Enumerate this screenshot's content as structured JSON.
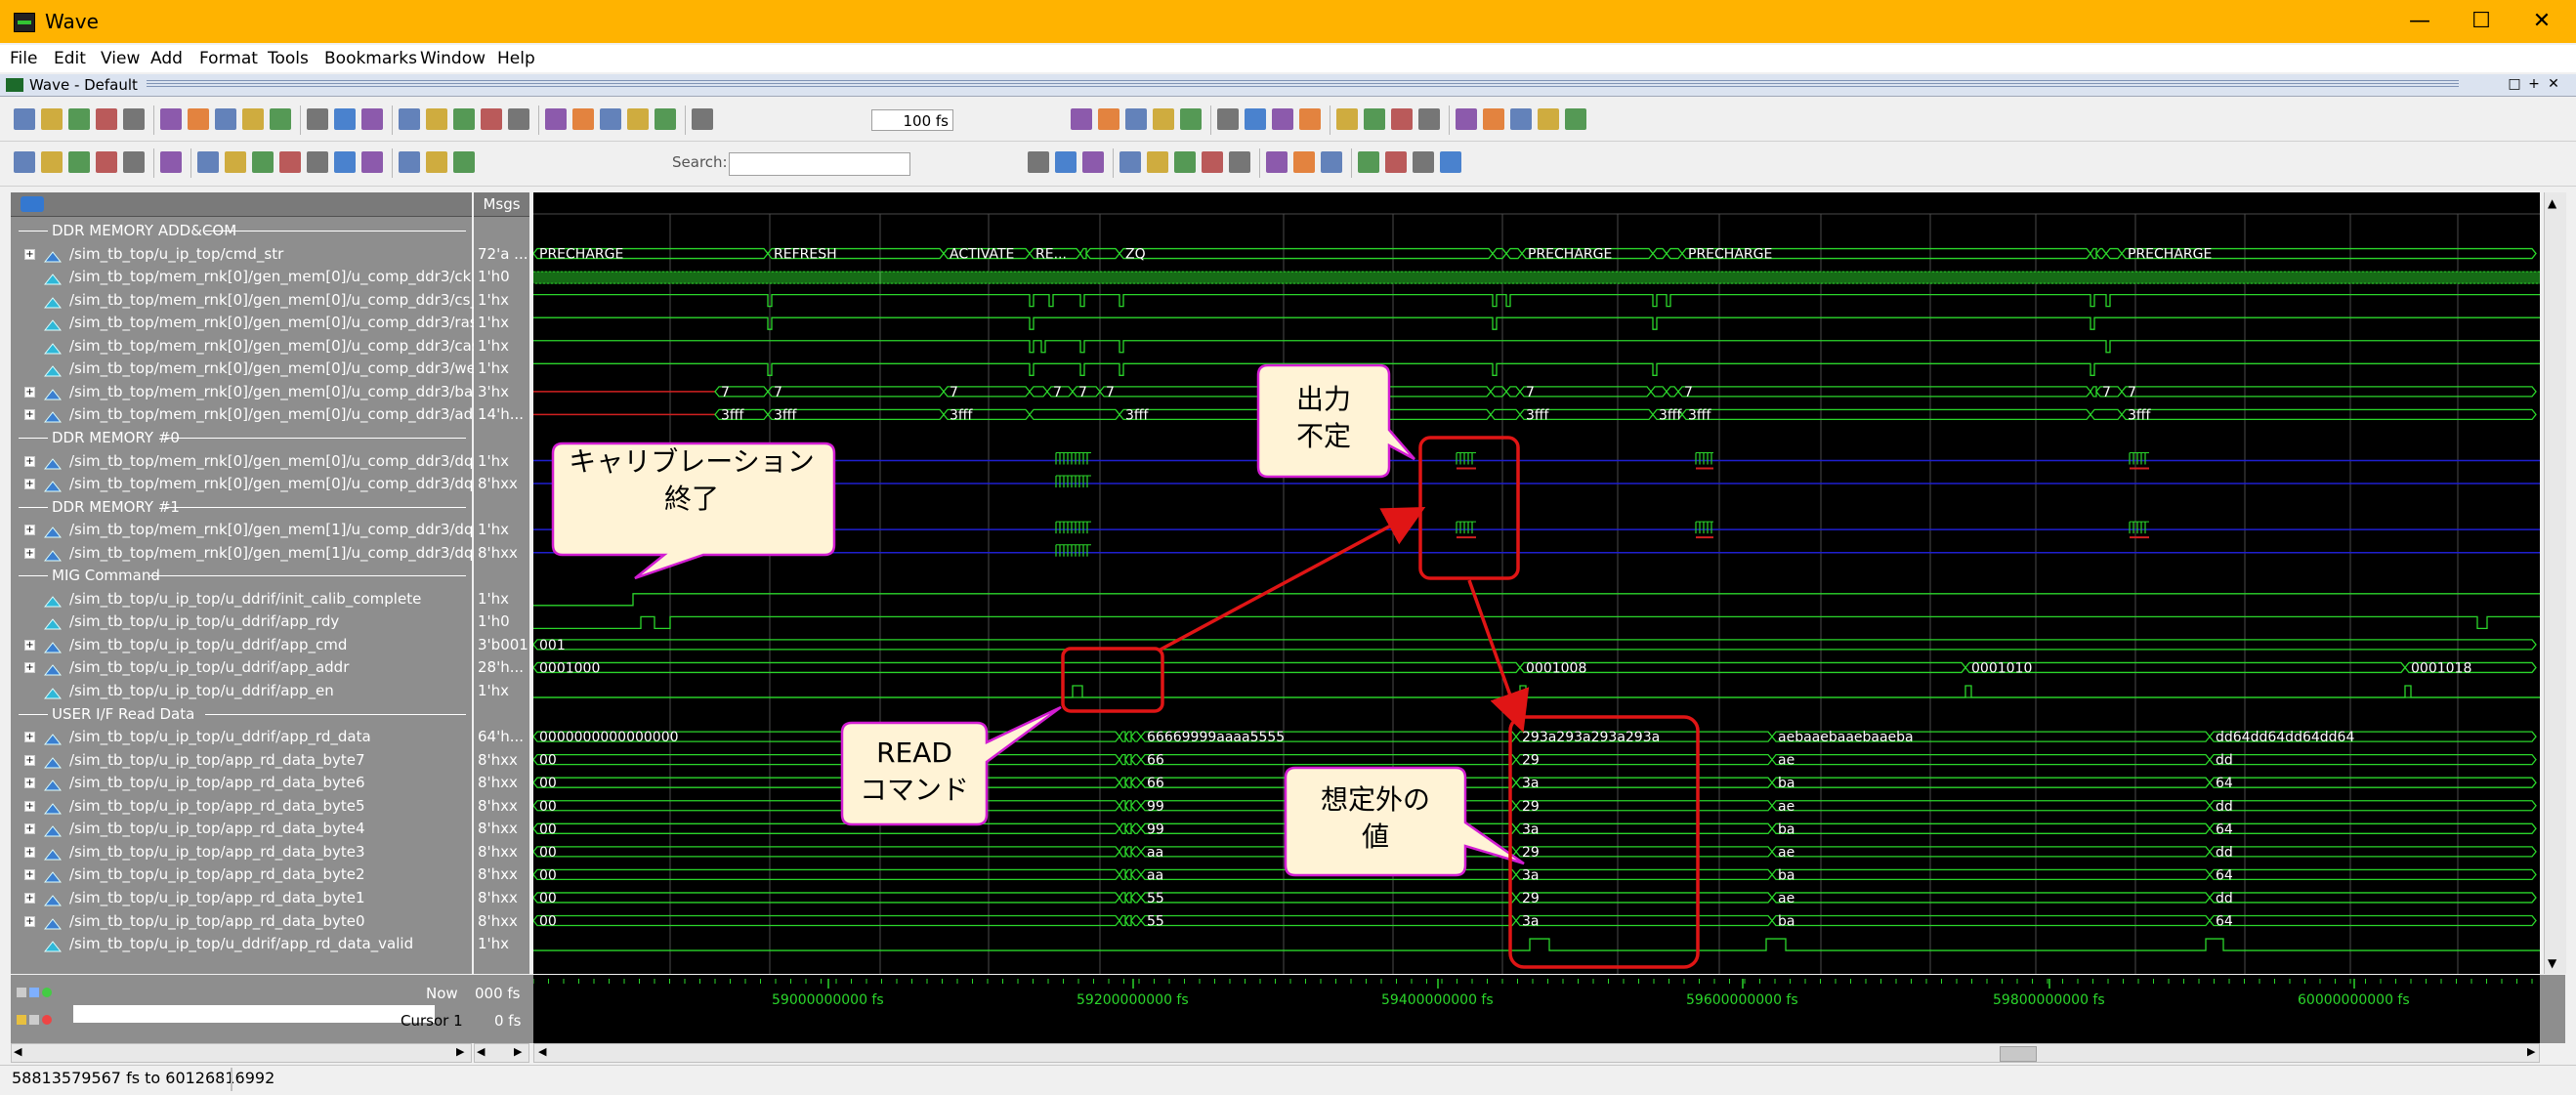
{
  "window": {
    "title": "Wave",
    "subwindow_title": "Wave - Default"
  },
  "menu": [
    "File",
    "Edit",
    "View",
    "Add",
    "Format",
    "Tools",
    "Bookmarks",
    "Window",
    "Help"
  ],
  "toolbar": {
    "zoom_value": "100 fs",
    "search_label": "Search:",
    "search_value": ""
  },
  "panes": {
    "msgs_header": "Msgs"
  },
  "signals": [
    {
      "type": "group",
      "name": "DDR MEMORY ADD&COM"
    },
    {
      "type": "bus",
      "name": "/sim_tb_top/u_ip_top/cmd_str",
      "value": "72'a ..."
    },
    {
      "type": "wire",
      "name": "/sim_tb_top/mem_rnk[0]/gen_mem[0]/u_comp_ddr3/ck",
      "value": "1'h0"
    },
    {
      "type": "wire",
      "name": "/sim_tb_top/mem_rnk[0]/gen_mem[0]/u_comp_ddr3/cs_n",
      "value": "1'hx"
    },
    {
      "type": "wire",
      "name": "/sim_tb_top/mem_rnk[0]/gen_mem[0]/u_comp_ddr3/ras_n",
      "value": "1'hx"
    },
    {
      "type": "wire",
      "name": "/sim_tb_top/mem_rnk[0]/gen_mem[0]/u_comp_ddr3/cas_n",
      "value": "1'hx"
    },
    {
      "type": "wire",
      "name": "/sim_tb_top/mem_rnk[0]/gen_mem[0]/u_comp_ddr3/we_n",
      "value": "1'hx"
    },
    {
      "type": "bus",
      "name": "/sim_tb_top/mem_rnk[0]/gen_mem[0]/u_comp_ddr3/ba",
      "value": "3'hx"
    },
    {
      "type": "bus",
      "name": "/sim_tb_top/mem_rnk[0]/gen_mem[0]/u_comp_ddr3/addr",
      "value": "14'h..."
    },
    {
      "type": "group",
      "name": "DDR MEMORY #0"
    },
    {
      "type": "bus",
      "name": "/sim_tb_top/mem_rnk[0]/gen_mem[0]/u_comp_ddr3/dqs",
      "value": "1'hx"
    },
    {
      "type": "bus",
      "name": "/sim_tb_top/mem_rnk[0]/gen_mem[0]/u_comp_ddr3/dq",
      "value": "8'hxx"
    },
    {
      "type": "group",
      "name": "DDR MEMORY #1"
    },
    {
      "type": "bus",
      "name": "/sim_tb_top/mem_rnk[0]/gen_mem[1]/u_comp_ddr3/dqs",
      "value": "1'hx"
    },
    {
      "type": "bus",
      "name": "/sim_tb_top/mem_rnk[0]/gen_mem[1]/u_comp_ddr3/dq",
      "value": "8'hxx"
    },
    {
      "type": "group",
      "name": "MIG Command"
    },
    {
      "type": "wire",
      "name": "/sim_tb_top/u_ip_top/u_ddrif/init_calib_complete",
      "value": "1'hx"
    },
    {
      "type": "wire",
      "name": "/sim_tb_top/u_ip_top/u_ddrif/app_rdy",
      "value": "1'h0"
    },
    {
      "type": "bus",
      "name": "/sim_tb_top/u_ip_top/u_ddrif/app_cmd",
      "value": "3'b001"
    },
    {
      "type": "bus",
      "name": "/sim_tb_top/u_ip_top/u_ddrif/app_addr",
      "value": "28'h..."
    },
    {
      "type": "wire",
      "name": "/sim_tb_top/u_ip_top/u_ddrif/app_en",
      "value": "1'hx"
    },
    {
      "type": "group",
      "name": "USER I/F Read Data"
    },
    {
      "type": "bus",
      "name": "/sim_tb_top/u_ip_top/u_ddrif/app_rd_data",
      "value": "64'h..."
    },
    {
      "type": "bus",
      "name": "/sim_tb_top/u_ip_top/app_rd_data_byte7",
      "value": "8'hxx"
    },
    {
      "type": "bus",
      "name": "/sim_tb_top/u_ip_top/app_rd_data_byte6",
      "value": "8'hxx"
    },
    {
      "type": "bus",
      "name": "/sim_tb_top/u_ip_top/app_rd_data_byte5",
      "value": "8'hxx"
    },
    {
      "type": "bus",
      "name": "/sim_tb_top/u_ip_top/app_rd_data_byte4",
      "value": "8'hxx"
    },
    {
      "type": "bus",
      "name": "/sim_tb_top/u_ip_top/app_rd_data_byte3",
      "value": "8'hxx"
    },
    {
      "type": "bus",
      "name": "/sim_tb_top/u_ip_top/app_rd_data_byte2",
      "value": "8'hxx"
    },
    {
      "type": "bus",
      "name": "/sim_tb_top/u_ip_top/app_rd_data_byte1",
      "value": "8'hxx"
    },
    {
      "type": "bus",
      "name": "/sim_tb_top/u_ip_top/app_rd_data_byte0",
      "value": "8'hxx"
    },
    {
      "type": "wire",
      "name": "/sim_tb_top/u_ip_top/u_ddrif/app_rd_data_valid",
      "value": "1'hx"
    }
  ],
  "wave_labels": {
    "cmd_str": [
      "PRECHARGE",
      "REFRESH",
      "ACTIVATE",
      "RE...",
      "ZQ",
      "PRECHARGE",
      "PRECHARGE",
      "PRECHARGE"
    ],
    "ba": [
      "7",
      "7",
      "7",
      "7",
      "7",
      "7",
      "7",
      "7",
      "7",
      "7"
    ],
    "addr": [
      "3fff",
      "3fff",
      "3fff",
      "3fff",
      "3fff",
      "3fff",
      "3fff",
      "3fff",
      "3fff"
    ],
    "app_cmd": "001",
    "app_addr": [
      "0001000",
      "0001008",
      "0001010",
      "0001018"
    ],
    "app_rd_data": [
      "0000000000000000",
      "66669999aaaa5555",
      "293a293a293a293a",
      "aebaaebaaebaaeba",
      "dd64dd64dd64dd64"
    ],
    "bytes": [
      [
        "00",
        "66",
        "29",
        "ae",
        "dd"
      ],
      [
        "00",
        "66",
        "3a",
        "ba",
        "64"
      ],
      [
        "00",
        "99",
        "29",
        "ae",
        "dd"
      ],
      [
        "00",
        "99",
        "3a",
        "ba",
        "64"
      ],
      [
        "00",
        "aa",
        "29",
        "ae",
        "dd"
      ],
      [
        "00",
        "aa",
        "3a",
        "ba",
        "64"
      ],
      [
        "00",
        "55",
        "29",
        "ae",
        "dd"
      ],
      [
        "00",
        "55",
        "3a",
        "ba",
        "64"
      ]
    ]
  },
  "cursor": {
    "now_label": "Now",
    "now_value": "000 fs",
    "cursor_label": "Cursor 1",
    "cursor_value": "0 fs"
  },
  "timeline": [
    "59000000000 fs",
    "59200000000 fs",
    "59400000000 fs",
    "59600000000 fs",
    "59800000000 fs",
    "60000000000 fs"
  ],
  "status": "58813579567 fs to 60126816992",
  "callouts": {
    "calib": "キャリブレーション\n終了",
    "unknown": "出力\n不定",
    "read": "READ\nコマンド",
    "unexpected": "想定外の\n値"
  },
  "colors": {
    "wave": "#2bd62b",
    "bus_blue": "#1f1fd0",
    "undefined": "#d02020",
    "callout_border": "#d21dd2",
    "callout_fill": "#fff3d6",
    "annotation_red": "#e01515"
  }
}
